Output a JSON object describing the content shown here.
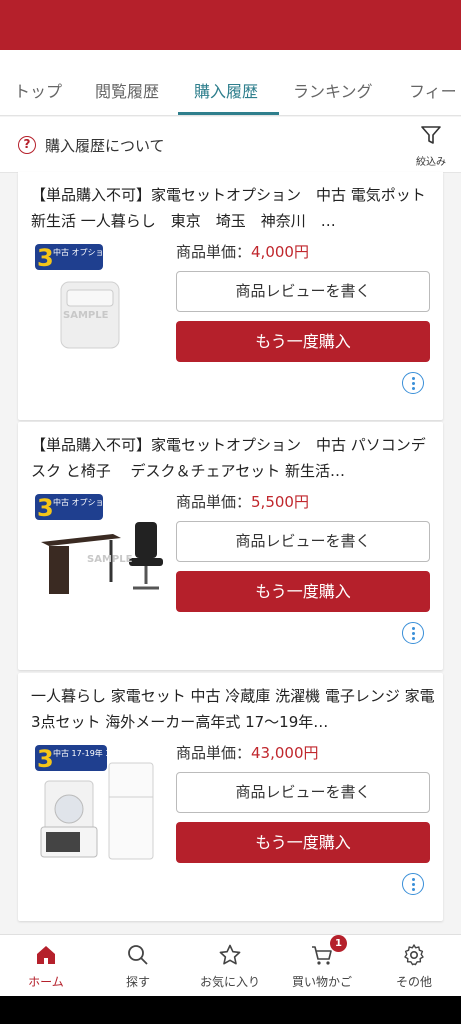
{
  "tabs": [
    {
      "label": "トップ"
    },
    {
      "label": "閲覧履歴"
    },
    {
      "label": "購入履歴"
    },
    {
      "label": "ランキング"
    },
    {
      "label": "フィー"
    }
  ],
  "info": {
    "help_label": "購入履歴について",
    "filter_label": "絞込み"
  },
  "items": [
    {
      "title": "【単品購入不可】家電セットオプション　中古 電気ポット 新生活 一人暮らし　東京　埼玉　神奈川　…",
      "price_label": "商品単価：",
      "price": "4,000円",
      "review_label": "商品レビューを書く",
      "buy_label": "もう一度購入",
      "image": "electric-pot-sample",
      "image_badge": "中古 オプション 3点セット",
      "watermark": "SAMPLE"
    },
    {
      "title": "【単品購入不可】家電セットオプション　中古 パソコンデスク と椅子　 デスク＆チェアセット 新生活…",
      "price_label": "商品単価：",
      "price": "5,500円",
      "review_label": "商品レビューを書く",
      "buy_label": "もう一度購入",
      "image": "desk-and-chair-sample",
      "image_badge": "中古 オプション 3点セット",
      "watermark": "SAMPLE"
    },
    {
      "title": "一人暮らし 家電セット 中古 冷蔵庫 洗濯機 電子レンジ 家電3点セット 海外メーカー高年式 17〜19年…",
      "price_label": "商品単価：",
      "price": "43,000円",
      "review_label": "商品レビューを書く",
      "buy_label": "もう一度購入",
      "image": "fridge-washer-microwave",
      "image_badge": "中古 17-19年 3点セット"
    }
  ],
  "nav": [
    {
      "label": "ホーム",
      "icon": "home-icon"
    },
    {
      "label": "探す",
      "icon": "search-icon"
    },
    {
      "label": "お気に入り",
      "icon": "star-icon"
    },
    {
      "label": "買い物かご",
      "icon": "cart-icon",
      "badge": "1"
    },
    {
      "label": "その他",
      "icon": "gear-icon"
    }
  ],
  "colors": {
    "brand": "#b5202b",
    "accent": "#2f7f8d",
    "price": "#c0272d",
    "link": "#3a8fd8"
  }
}
